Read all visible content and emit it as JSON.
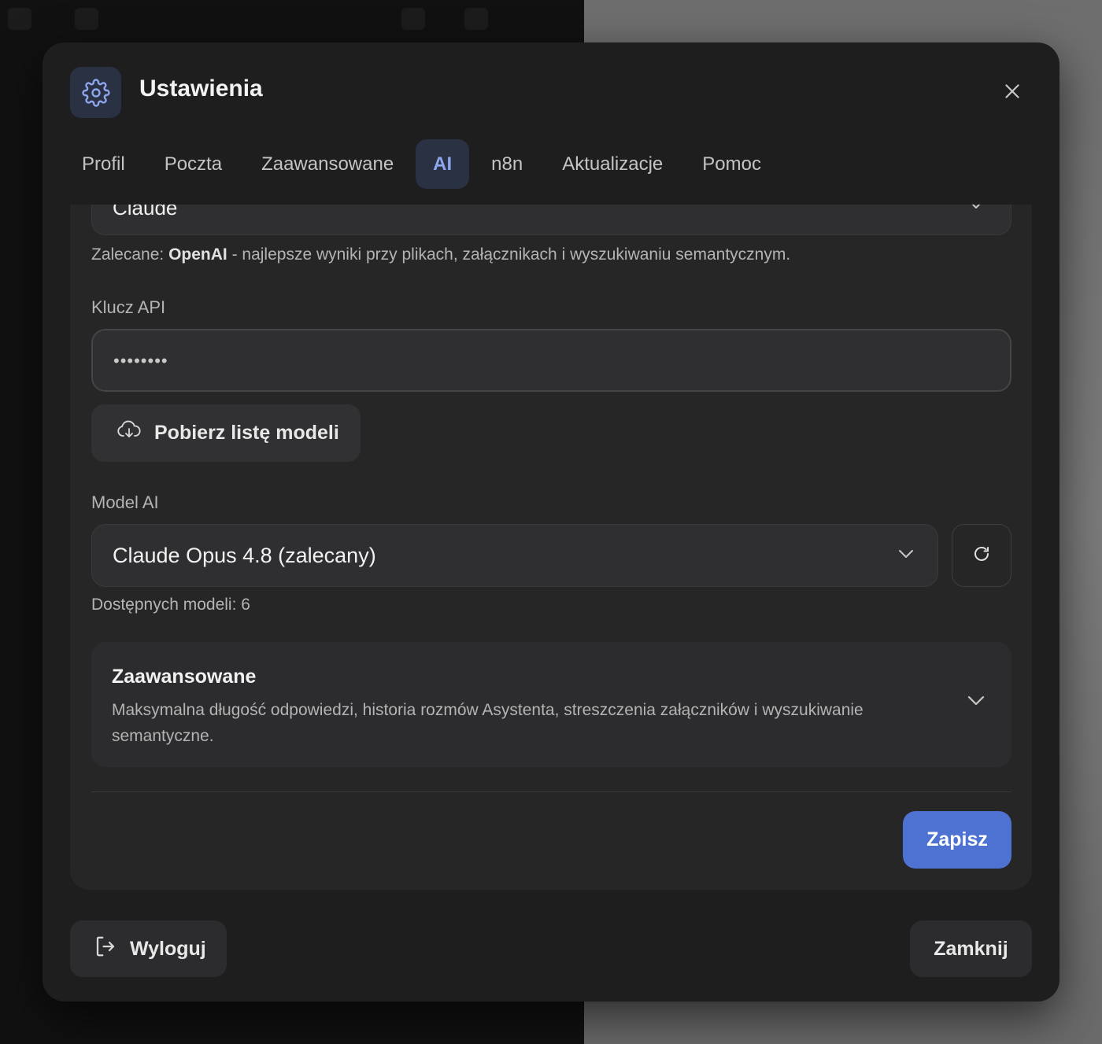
{
  "dialog": {
    "title": "Ustawienia",
    "header_icon": "gear-icon",
    "close_icon": "close-icon"
  },
  "tabs": [
    {
      "label": "Profil",
      "active": false
    },
    {
      "label": "Poczta",
      "active": false
    },
    {
      "label": "Zaawansowane",
      "active": false
    },
    {
      "label": "AI",
      "active": true
    },
    {
      "label": "n8n",
      "active": false
    },
    {
      "label": "Aktualizacje",
      "active": false
    },
    {
      "label": "Pomoc",
      "active": false
    }
  ],
  "ai": {
    "provider_value": "Claude",
    "recommendation_prefix": "Zalecane: ",
    "recommendation_bold": "OpenAI",
    "recommendation_rest": " - najlepsze wyniki przy plikach, załącznikach i wyszukiwaniu semantycznym.",
    "api_key_label": "Klucz API",
    "api_key_value": "••••••••",
    "fetch_models_label": "Pobierz listę modeli",
    "fetch_icon": "cloud-download-icon",
    "model_label": "Model AI",
    "model_value": "Claude Opus 4.8 (zalecany)",
    "refresh_icon": "refresh-icon",
    "models_count_text": "Dostępnych modeli: 6",
    "advanced_title": "Zaawansowane",
    "advanced_description": "Maksymalna długość odpowiedzi, historia rozmów Asystenta, streszczenia załączników i wyszukiwanie semantyczne.",
    "save_label": "Zapisz"
  },
  "footer": {
    "logout_label": "Wyloguj",
    "logout_icon": "logout-icon",
    "close_label": "Zamknij"
  },
  "colors": {
    "accent": "#4d72d1",
    "active_tab_bg": "#2a3143",
    "active_tab_text": "#8da6ee",
    "modal_bg": "#1e1e1f"
  }
}
